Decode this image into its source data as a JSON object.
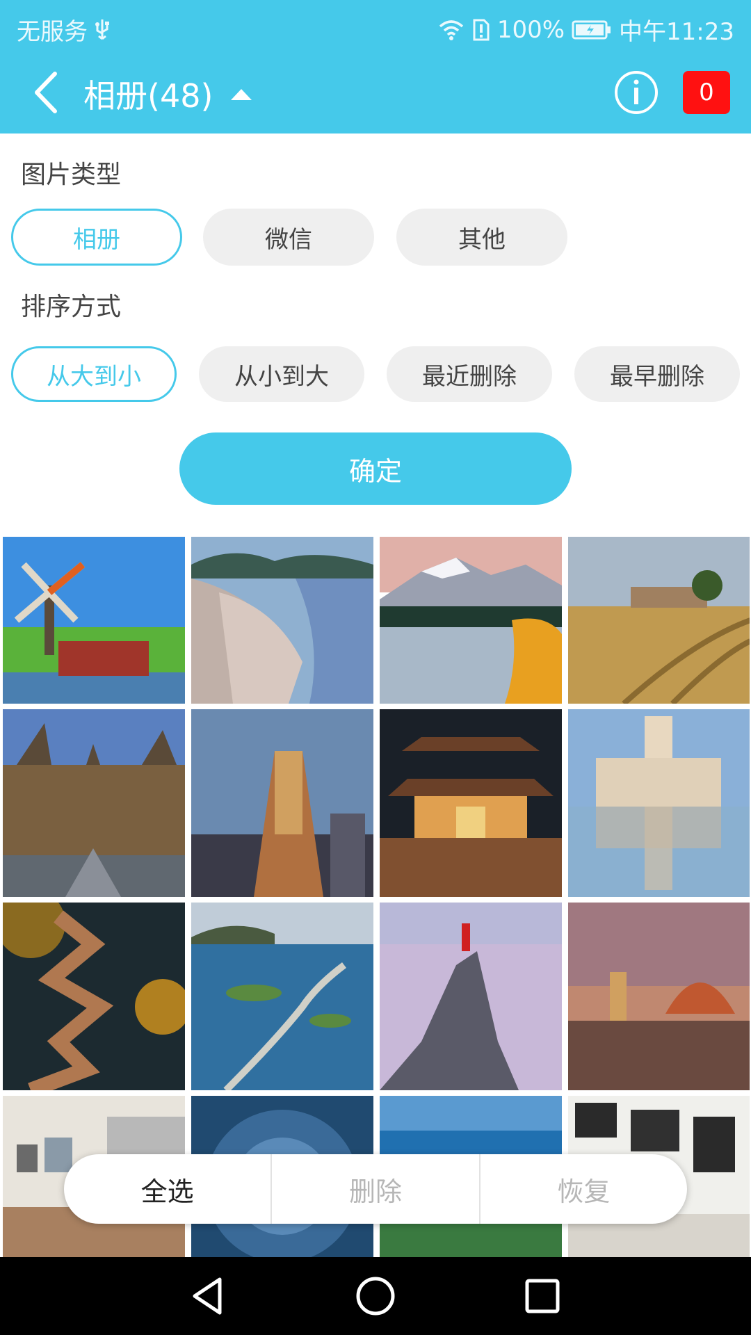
{
  "status_bar": {
    "carrier": "无服务",
    "battery": "100%",
    "time": "中午11:23"
  },
  "header": {
    "title": "相册(48)",
    "badge_count": "0"
  },
  "filters": {
    "type_label": "图片类型",
    "types": [
      {
        "label": "相册",
        "active": true
      },
      {
        "label": "微信",
        "active": false
      },
      {
        "label": "其他",
        "active": false
      }
    ],
    "sort_label": "排序方式",
    "sorts": [
      {
        "label": "从大到小",
        "active": true
      },
      {
        "label": "从小到大",
        "active": false
      },
      {
        "label": "最近删除",
        "active": false
      },
      {
        "label": "最早删除",
        "active": false
      }
    ],
    "confirm": "确定"
  },
  "photos": [
    "windmill",
    "harbor-town",
    "mountain-lake",
    "wheat-field",
    "old-town-street",
    "city-tower",
    "chinese-temple",
    "palace-reflection",
    "forest-path",
    "ocean-road",
    "cliff-hiker",
    "cathedral-dusk",
    "interior-room",
    "spiral-eye",
    "ocean-coast",
    "gallery-wall"
  ],
  "actions": {
    "select_all": "全选",
    "delete": "删除",
    "restore": "恢复"
  },
  "colors": {
    "accent": "#45c9ea",
    "badge": "#ff1111"
  }
}
